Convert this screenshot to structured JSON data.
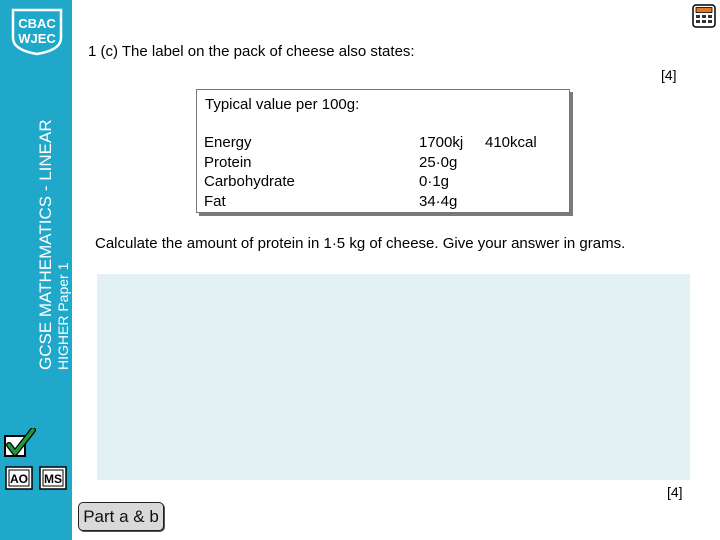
{
  "sidebar": {
    "logo_line1": "CBAC",
    "logo_line2": "WJEC",
    "title": "GCSE MATHEMATICS - LINEAR",
    "subtitle": "HIGHER Paper 1",
    "icons": [
      "tick-icon",
      "ao-icon",
      "ms-icon"
    ]
  },
  "header": {
    "question": "1 (c) The label on the pack of cheese also states:",
    "marks": "[4]",
    "calculator_icon": "calculator-icon"
  },
  "nutrition": {
    "heading": "Typical value per 100g:",
    "rows": [
      {
        "name": "Energy",
        "value": "1700kj",
        "extra": "410kcal"
      },
      {
        "name": "Protein",
        "value": "25·0g"
      },
      {
        "name": "Carbohydrate",
        "value": "0·1g"
      },
      {
        "name": "Fat",
        "value": "34·4g"
      }
    ]
  },
  "instruction": "Calculate the amount of protein in 1·5 kg of cheese. Give your answer in grams.",
  "answer": {
    "marks": "[4]"
  },
  "nav": {
    "part_button": "Part a & b"
  },
  "colors": {
    "sidebar": "#1fa8c9",
    "answer_area": "#e4f1f4",
    "tick_green": "#1e9a3c"
  }
}
